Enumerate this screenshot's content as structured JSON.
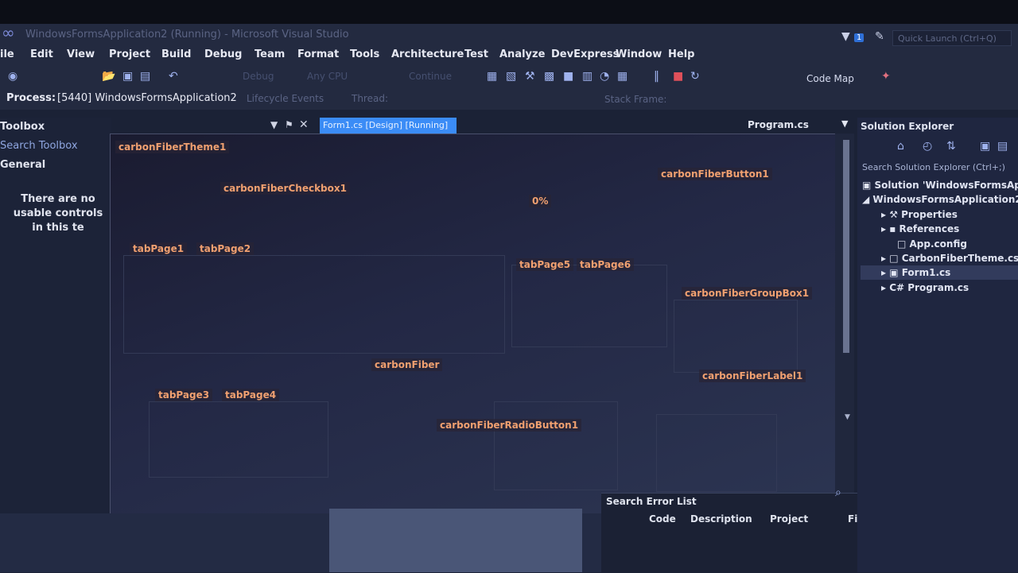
{
  "window": {
    "title": "WindowsFormsApplication2 (Running) - Microsoft Visual Studio",
    "notification_count": "1",
    "quick_launch_placeholder": "Quick Launch (Ctrl+Q)"
  },
  "menu": [
    "ile",
    "Edit",
    "View",
    "Project",
    "Build",
    "Debug",
    "Team",
    "Format",
    "Tools",
    "Architecture",
    "Test",
    "Analyze",
    "DevExpress",
    "Window",
    "Help"
  ],
  "toolbar": {
    "config": "Debug",
    "platform": "Any CPU",
    "continue": "Continue",
    "code_map": "Code Map"
  },
  "process_bar": {
    "label": "Process:",
    "value": "[5440] WindowsFormsApplication2",
    "lifecycle": "Lifecycle Events",
    "thread": "Thread:",
    "stack_frame": "Stack Frame:"
  },
  "toolbox": {
    "title": "Toolbox",
    "search": "Search Toolbox",
    "group": "General",
    "empty_text": "There are no usable controls in this te"
  },
  "tabs": {
    "active": "Form1.cs [Design] [Running]",
    "program": "Program.cs"
  },
  "form": {
    "theme": "carbonFiberTheme1",
    "checkbox": "carbonFiberCheckbox1",
    "button": "carbonFiberButton1",
    "progress": "0%",
    "tab_page1": "tabPage1",
    "tab_page2": "tabPage2",
    "tab_page5": "tabPage5",
    "tab_page6": "tabPage6",
    "group_box": "carbonFiberGroupBox1",
    "tab_page3": "tabPage3",
    "tab_page4": "tabPage4",
    "fiber_button2": "carbonFiber",
    "label": "carbonFiberLabel1",
    "radio": "carbonFiberRadioButton1"
  },
  "solution_explorer": {
    "title": "Solution Explorer",
    "search": "Search Solution Explorer (Ctrl+;)",
    "items": [
      {
        "label": "Solution 'WindowsFormsApplicat"
      },
      {
        "label": "WindowsFormsApplication2"
      },
      {
        "label": "Properties"
      },
      {
        "label": "References"
      },
      {
        "label": "App.config"
      },
      {
        "label": "CarbonFiberTheme.cs"
      },
      {
        "label": "Form1.cs"
      },
      {
        "label": "Program.cs"
      }
    ]
  },
  "error_list": {
    "search": "Search Error List",
    "columns": [
      "Code",
      "Description",
      "Project",
      "Fi"
    ]
  },
  "colors": {
    "label_orange": "#f0a070",
    "selection_blue": "#3b8cf6",
    "ide_dark": "#232a40"
  }
}
